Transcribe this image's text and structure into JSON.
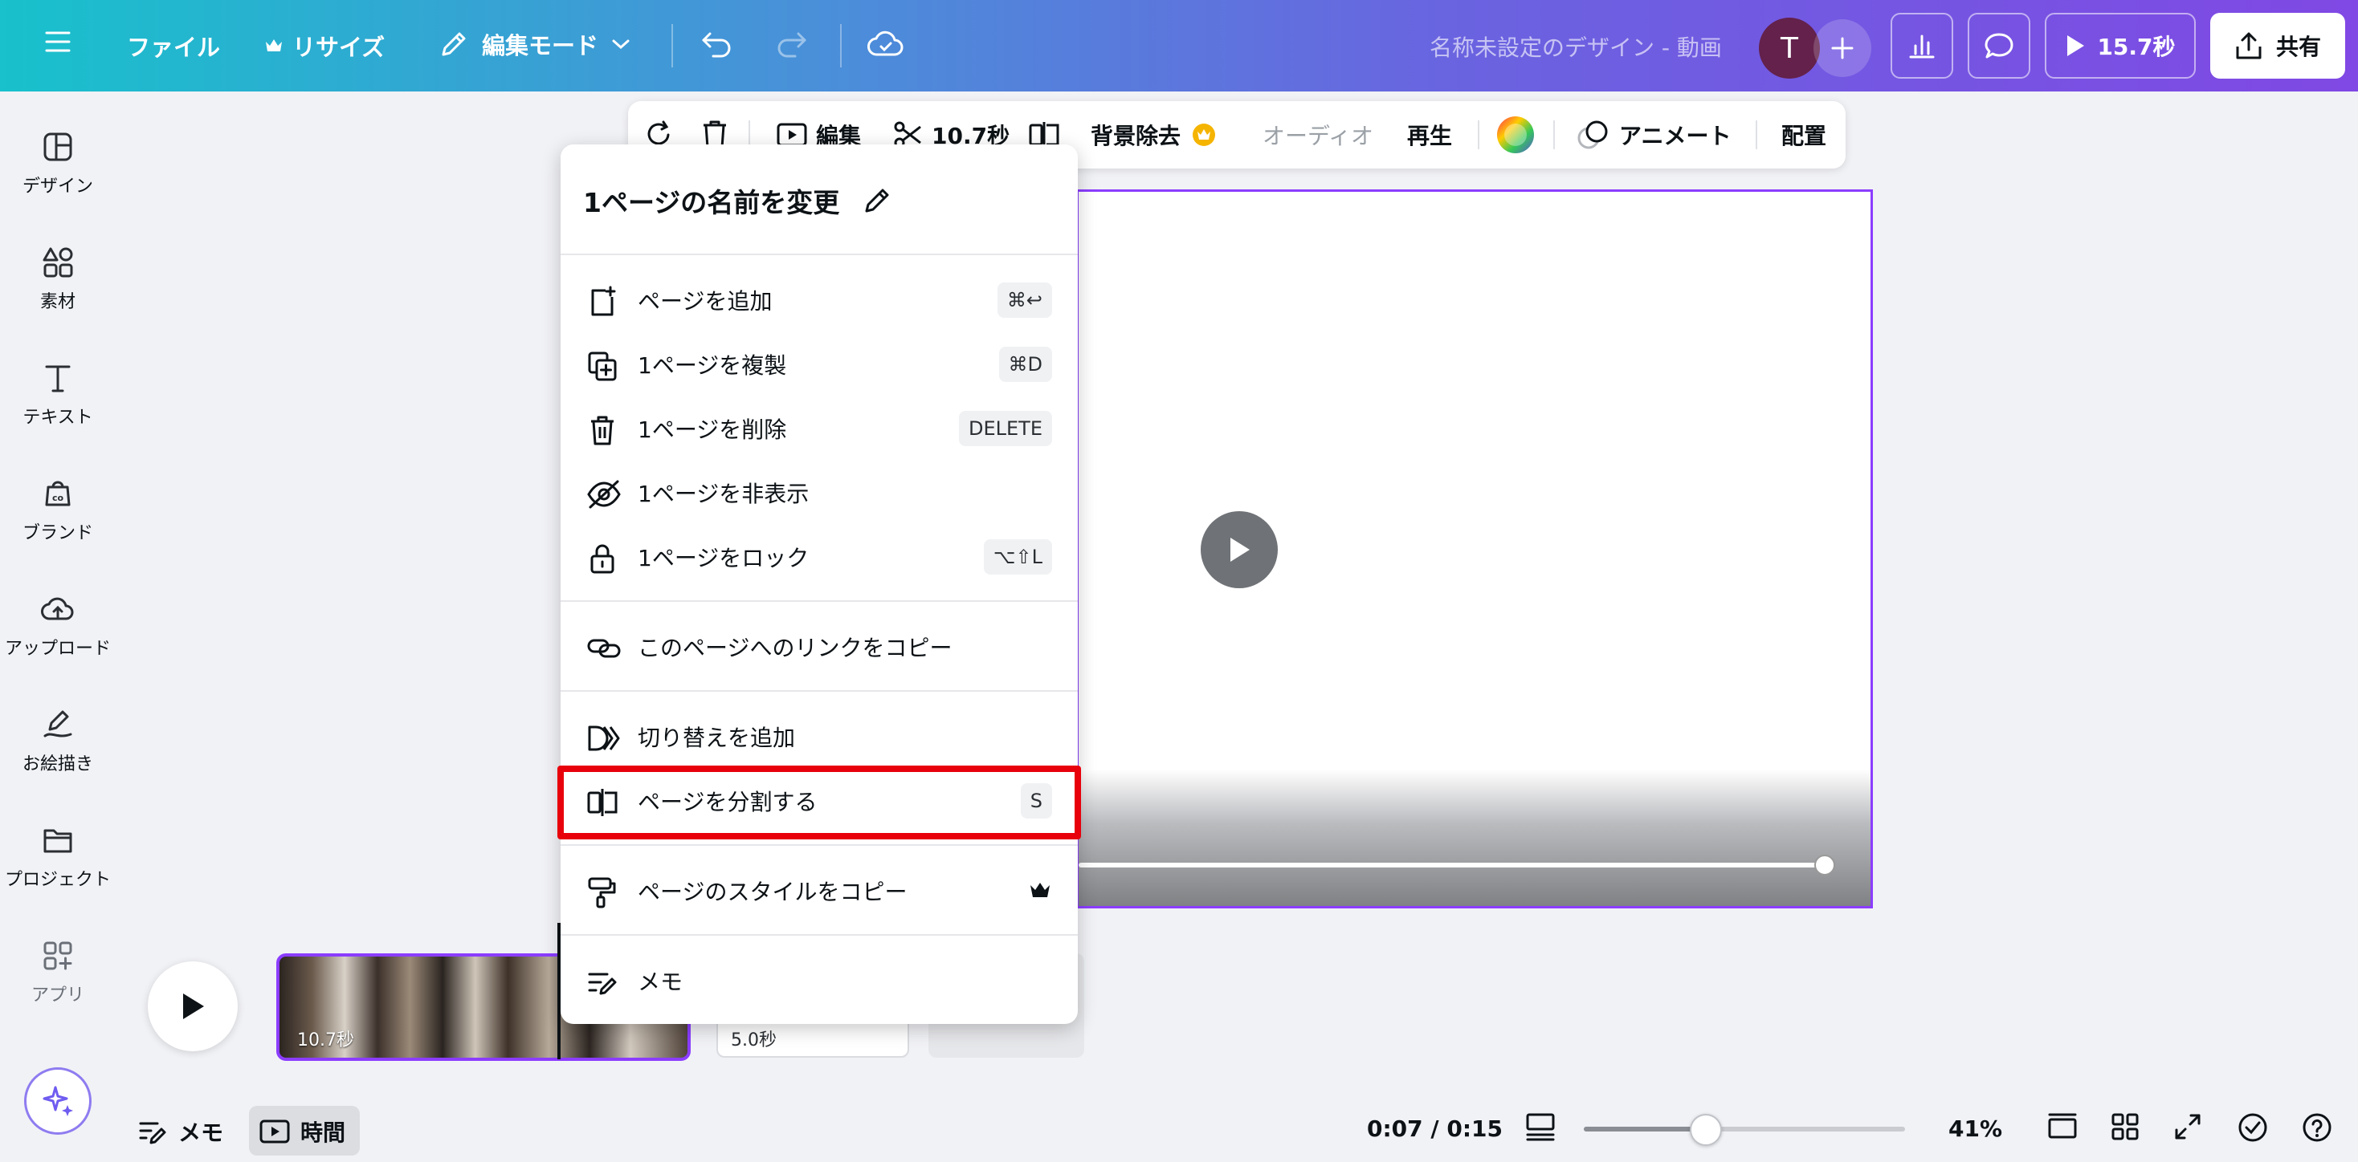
{
  "topbar": {
    "file": "ファイル",
    "resize": "リサイズ",
    "edit_mode": "編集モード",
    "doc_title": "名称未設定のデザイン - 動画",
    "avatar_initial": "T",
    "play_duration": "15.7秒",
    "share": "共有"
  },
  "sidebar": {
    "items": [
      {
        "label": "デザイン",
        "icon": "design-icon"
      },
      {
        "label": "素材",
        "icon": "elements-icon"
      },
      {
        "label": "テキスト",
        "icon": "text-icon"
      },
      {
        "label": "ブランド",
        "icon": "brand-icon"
      },
      {
        "label": "アップロード",
        "icon": "upload-icon"
      },
      {
        "label": "お絵描き",
        "icon": "draw-icon"
      },
      {
        "label": "プロジェクト",
        "icon": "folder-icon"
      },
      {
        "label": "アプリ",
        "icon": "apps-icon"
      }
    ]
  },
  "toolbar": {
    "edit": "編集",
    "trim": "10.7秒",
    "bg_remove": "背景除去",
    "audio": "オーディオ",
    "playback": "再生",
    "animate": "アニメート",
    "position": "配置"
  },
  "menu": {
    "title": "1ページの名前を変更",
    "items": [
      {
        "label": "ページを追加",
        "shortcut": "⌘↩",
        "icon": "add-page-icon"
      },
      {
        "label": "1ページを複製",
        "shortcut": "⌘D",
        "icon": "duplicate-icon"
      },
      {
        "label": "1ページを削除",
        "shortcut": "DELETE",
        "icon": "trash-icon"
      },
      {
        "label": "1ページを非表示",
        "shortcut": "",
        "icon": "hide-icon"
      },
      {
        "label": "1ページをロック",
        "shortcut": "⌥⇧L",
        "icon": "lock-icon"
      },
      {
        "label": "このページへのリンクをコピー",
        "shortcut": "",
        "icon": "link-icon"
      },
      {
        "label": "切り替えを追加",
        "shortcut": "",
        "icon": "transition-icon"
      },
      {
        "label": "ページを分割する",
        "shortcut": "S",
        "icon": "split-icon"
      },
      {
        "label": "ページのスタイルをコピー",
        "shortcut": "",
        "icon": "paint-roller-icon"
      },
      {
        "label": "メモ",
        "shortcut": "",
        "icon": "notes-icon"
      }
    ]
  },
  "timeline": {
    "clip1_duration": "10.7秒",
    "clip2_duration": "5.0秒"
  },
  "bottombar": {
    "notes": "メモ",
    "time": "時間",
    "timecode": "0:07 / 0:15",
    "zoom": "41%",
    "zoom_level": 0.38
  },
  "colors": {
    "accent": "#8b3dff",
    "highlight": "#e8000b",
    "topbar_start": "#18c1cc",
    "topbar_end": "#8048e4"
  }
}
